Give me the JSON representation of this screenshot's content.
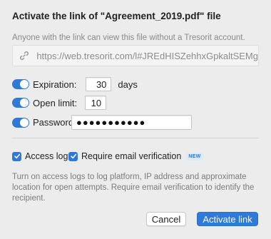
{
  "dialog": {
    "title": "Activate the link of \"Agreement_2019.pdf\" file",
    "subtitle": "Anyone with the link can view this file without a Tresorit account.",
    "link_url": "https://web.tresorit.com/l#JREdHISZehhxGpkaltSEMg"
  },
  "settings": {
    "expiration": {
      "label": "Expiration:",
      "value": "30",
      "suffix": "days",
      "enabled": true
    },
    "open_limit": {
      "label": "Open limit:",
      "value": "10",
      "enabled": true
    },
    "password": {
      "label": "Password:",
      "value": "●●●●●●●●●●●",
      "enabled": true
    }
  },
  "options": {
    "access_logs": {
      "label": "Access logs",
      "checked": true
    },
    "require_email": {
      "label": "Require email verification",
      "checked": true,
      "badge": "NEW"
    }
  },
  "help_text": "Turn on access logs to log platform, IP address and approximate location for open attempts. Require email verification to identify the recipient.",
  "buttons": {
    "cancel": "Cancel",
    "activate": "Activate link"
  },
  "colors": {
    "accent": "#2f7ad9",
    "background": "#ececec"
  }
}
